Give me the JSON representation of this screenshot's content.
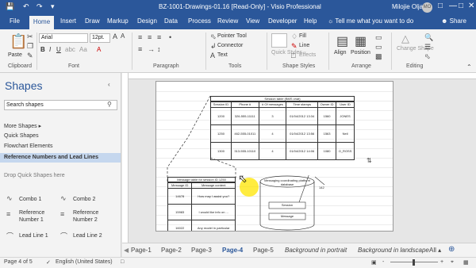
{
  "titlebar": {
    "doc_title": "BZ-1001-Drawings-01.16  [Read-Only]  -  Visio Professional",
    "user_name": "Milojie Oljaca",
    "user_initials": "MO",
    "qat": [
      "save-icon",
      "undo-icon",
      "redo-icon",
      "customize-icon"
    ]
  },
  "tabs": [
    "File",
    "Home",
    "Insert",
    "Draw",
    "Markup",
    "Design",
    "Data",
    "Process",
    "Review",
    "View",
    "Developer",
    "Help"
  ],
  "tell_me": "Tell me what you want to do",
  "share": "Share",
  "ribbon": {
    "clipboard": {
      "label": "Clipboard",
      "paste": "Paste"
    },
    "font": {
      "label": "Font",
      "name": "Arial",
      "size": "12pt."
    },
    "paragraph": {
      "label": "Paragraph"
    },
    "tools": {
      "label": "Tools",
      "pointer": "Pointer Tool",
      "connector": "Connector",
      "text": "Text"
    },
    "shape_styles": {
      "label": "Shape Styles",
      "fill": "Fill",
      "line": "Line",
      "effects": "Effects",
      "quick_styles": "Quick Styles"
    },
    "arrange": {
      "label": "Arrange",
      "align": "Align",
      "position": "Position"
    },
    "editing": {
      "label": "Editing",
      "change_shape": "Change Shape"
    }
  },
  "shapes_pane": {
    "title": "Shapes",
    "search_placeholder": "Search shapes",
    "items": [
      "More Shapes",
      "Quick Shapes",
      "Flowchart Elements",
      "Reference Numbers and Lead Lines"
    ],
    "drop_hint": "Drop Quick Shapes here",
    "stencils": [
      {
        "name": "Combo 1",
        "icon": "combo-icon"
      },
      {
        "name": "Combo 2",
        "icon": "combo-icon"
      },
      {
        "name": "Reference Number 1",
        "icon": "reference-number-icon"
      },
      {
        "name": "Reference Number 2",
        "icon": "reference-number-icon"
      },
      {
        "name": "Lead Line 1",
        "icon": "lead-line-icon"
      },
      {
        "name": "Lead Line 2",
        "icon": "lead-line-icon"
      }
    ]
  },
  "drawing": {
    "session_table": {
      "caption": "Session table (BMS chat)",
      "headers": [
        "Session ID",
        "Phone #",
        "# Of messages",
        "Time stamps",
        "Owner ID",
        "User ID"
      ],
      "rows": [
        [
          "1200",
          "326-555-11111",
          "3",
          "01/04/2012 13:34",
          "1560",
          "JONES"
        ],
        [
          "1250",
          "462-555-01011",
          "4",
          "01/04/2012 13:56",
          "1563",
          "Neil"
        ],
        [
          "1300",
          "313-555-10110",
          "4",
          "01/04/2012 14:06",
          "1080",
          "O_ROSS"
        ]
      ]
    },
    "message_table": {
      "caption": "Message table for session ID 1250",
      "headers": [
        "Message ID",
        "Message content"
      ],
      "rows": [
        [
          "14678",
          "How may I assist you?"
        ],
        [
          "15983",
          "I would like info on ..."
        ],
        [
          "16022",
          "Any model in particular"
        ]
      ]
    },
    "database": {
      "label": "Messaging coordinating platform database",
      "ref": "142",
      "inner": [
        "Session",
        "Message"
      ]
    }
  },
  "pages": [
    "Page-1",
    "Page-2",
    "Page-3",
    "Page-4",
    "Page-5",
    "Background in portrait",
    "Background in landscape",
    "All"
  ],
  "active_page": "Page-4",
  "status": {
    "page_info": "Page 4 of 5",
    "language": "English (United States)",
    "zoom": "-"
  }
}
